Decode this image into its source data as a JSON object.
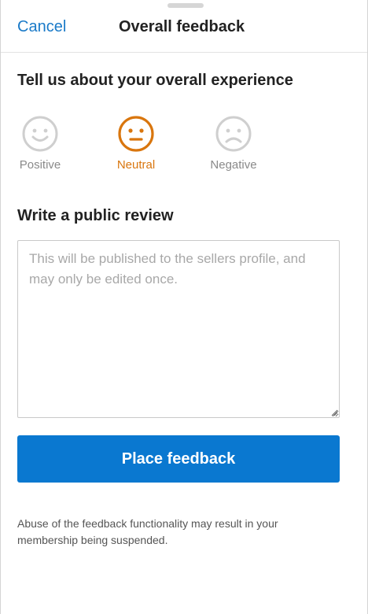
{
  "header": {
    "cancel_label": "Cancel",
    "title": "Overall feedback"
  },
  "experience": {
    "heading": "Tell us about your overall experience",
    "selected": "Neutral",
    "options": [
      {
        "label": "Positive",
        "icon": "smile-face-icon"
      },
      {
        "label": "Neutral",
        "icon": "neutral-face-icon"
      },
      {
        "label": "Negative",
        "icon": "sad-face-icon"
      }
    ]
  },
  "review": {
    "heading": "Write a public review",
    "value": "",
    "placeholder": "This will be published to the sellers profile, and may only be edited once."
  },
  "submit": {
    "label": "Place feedback"
  },
  "footer": {
    "disclaimer": "Abuse of the feedback functionality may result in your membership being suspended."
  },
  "colors": {
    "accent_blue": "#0a78d0",
    "link_blue": "#1a7ac8",
    "selected_orange": "#d9760e",
    "inactive_gray": "#cfcfcf"
  }
}
